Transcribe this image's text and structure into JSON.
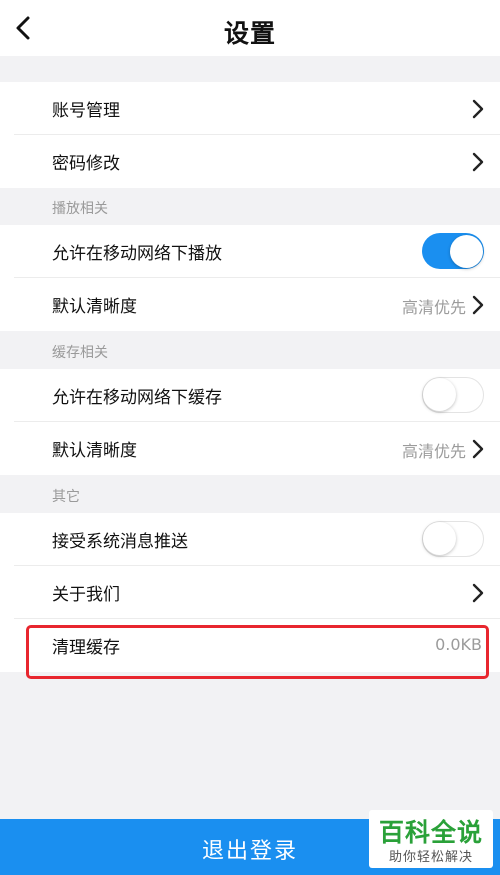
{
  "header": {
    "title": "设置"
  },
  "account": {
    "manage_label": "账号管理",
    "password_label": "密码修改"
  },
  "playback": {
    "section_label": "播放相关",
    "mobile_play_label": "允许在移动网络下播放",
    "mobile_play_enabled": true,
    "default_quality_label": "默认清晰度",
    "default_quality_value": "高清优先"
  },
  "cache": {
    "section_label": "缓存相关",
    "mobile_cache_label": "允许在移动网络下缓存",
    "mobile_cache_enabled": false,
    "default_quality_label": "默认清晰度",
    "default_quality_value": "高清优先"
  },
  "other": {
    "section_label": "其它",
    "push_label": "接受系统消息推送",
    "push_enabled": false,
    "about_label": "关于我们",
    "clear_cache_label": "清理缓存",
    "cache_size": "0.0KB"
  },
  "footer": {
    "logout_label": "退出登录"
  },
  "watermark": {
    "title": "百科全说",
    "subtitle": "助你轻松解决"
  },
  "colors": {
    "accent": "#1a8ff0",
    "highlight": "#e8262e",
    "watermark": "#2aa139"
  }
}
